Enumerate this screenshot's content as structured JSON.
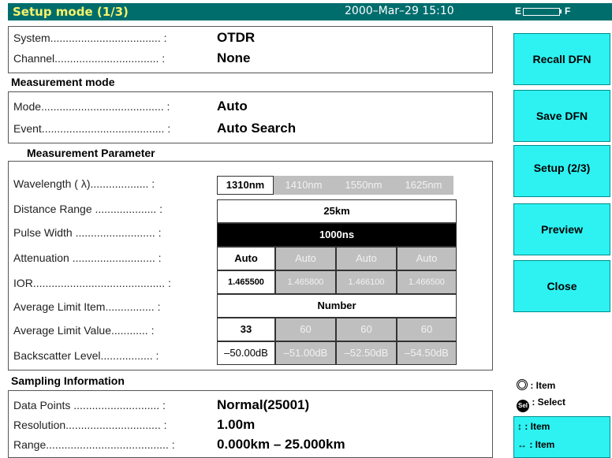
{
  "header": {
    "title": "Setup mode (1/3)",
    "datetime": "2000–Mar–29 15:10",
    "battery_empty": "E",
    "battery_full": "F"
  },
  "system": {
    "system_label": "System.................................... :",
    "system_value": "OTDR",
    "channel_label": "Channel.................................. :",
    "channel_value": "None"
  },
  "measurement_mode": {
    "heading": "Measurement mode",
    "mode_label": "Mode........................................ :",
    "mode_value": "Auto",
    "event_label": "Event........................................ :",
    "event_value": "Auto Search"
  },
  "measurement_parameter": {
    "heading": "Measurement Parameter",
    "labels": {
      "wavelength": "Wavelength ( λ)................... :",
      "distance_range": "Distance Range .................... :",
      "pulse_width": "Pulse Width .......................... :",
      "attenuation": "Attenuation ........................... :",
      "ior": "IOR........................................... :",
      "average_limit_item": "Average Limit Item................ :",
      "average_limit_value": "Average Limit Value............ :",
      "backscatter_level": "Backscatter Level................. :"
    },
    "wavelengths": [
      "1310nm",
      "1410nm",
      "1550nm",
      "1625nm"
    ],
    "distance_range": "25km",
    "pulse_width": "1000ns",
    "attenuation": [
      "Auto",
      "Auto",
      "Auto",
      "Auto"
    ],
    "ior": [
      "1.465500",
      "1.465800",
      "1.466100",
      "1.466500"
    ],
    "average_limit_item": "Number",
    "average_limit_value": [
      "33",
      "60",
      "60",
      "60"
    ],
    "backscatter_level": [
      "–50.00dB",
      "–51.00dB",
      "–52.50dB",
      "–54.50dB"
    ]
  },
  "sampling": {
    "heading": "Sampling Information",
    "data_points_label": "Data Points ............................ :",
    "data_points_value": "Normal(25001)",
    "resolution_label": "Resolution............................... :",
    "resolution_value": "1.00m",
    "range_label": "Range........................................ :",
    "range_value": "0.000km – 25.000km"
  },
  "sidebar": {
    "buttons": [
      "Recall DFN",
      "Save DFN",
      "Setup (2/3)",
      "Preview",
      "Close"
    ],
    "legend": {
      "item1": ": Item",
      "select": ": Select",
      "arrow_updown": ": Item",
      "arrow_leftright": ": Item"
    }
  },
  "colors": {
    "title_bar": "#006d6d",
    "title_text": "#f8f26a",
    "button": "#2ef2f2",
    "dim_cell": "#bfbfbf"
  }
}
